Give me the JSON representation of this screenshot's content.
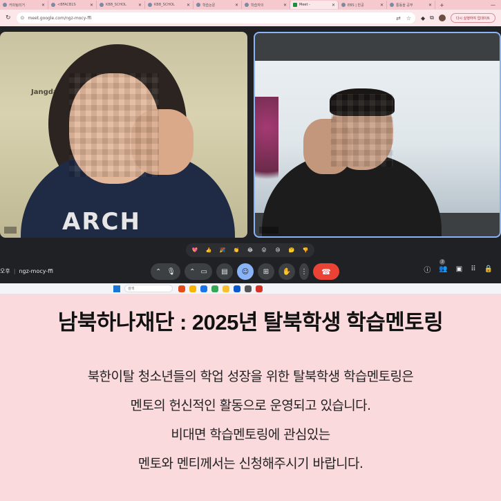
{
  "browser": {
    "tabs": [
      {
        "label": "커피팀리거",
        "active": false
      },
      {
        "label": "<BFACB1S",
        "active": false
      },
      {
        "label": "KBB_SCHOL",
        "active": false
      },
      {
        "label": "KBB_SCHOL",
        "active": false
      },
      {
        "label": "학습논문",
        "active": false
      },
      {
        "label": "학습자의",
        "active": false
      },
      {
        "label": "Meet -",
        "active": true
      },
      {
        "label": "EBS | 만공",
        "active": false
      },
      {
        "label": "통동을 공부",
        "active": false
      }
    ],
    "url": "meet.google.com/ngz-mocy-ffi",
    "relaunch_label": "다시 실행하여 업데이트"
  },
  "meet": {
    "left_wall_text": "Jangdae",
    "left_shirt_text": "ARCH",
    "reactions": [
      "💖",
      "👍",
      "🎉",
      "👏",
      "😂",
      "😮",
      "😢",
      "🤔",
      "👎"
    ],
    "meeting_time": "오후",
    "meeting_code": "ngz-mocy-ffi",
    "participants_count": "2",
    "accent": "#8ab4f8",
    "end_call_color": "#ea4335"
  },
  "taskbar": {
    "search_label": "검색"
  },
  "caption": {
    "title": "남북하나재단 : 2025년 탈북학생 학습멘토링",
    "lines": [
      "북한이탈 청소년들의 학업 성장을 위한 탈북학생 학습멘토링은",
      "멘토의 헌신적인 활동으로 운영되고 있습니다.",
      "비대면 학습멘토링에 관심있는",
      "멘토와 멘티께서는 신청해주시기 바랍니다."
    ],
    "background": "#fadadd"
  }
}
